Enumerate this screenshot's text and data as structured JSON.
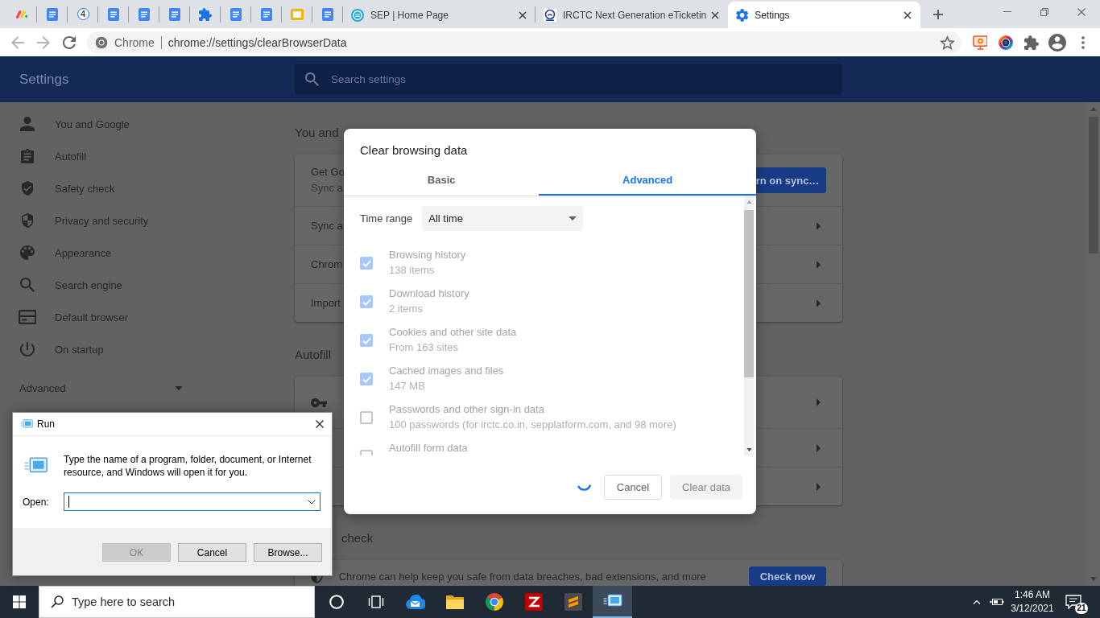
{
  "browser": {
    "pinned_tabs": [
      {
        "kind": "monday"
      },
      {
        "kind": "docs"
      },
      {
        "kind": "badge",
        "label": "4"
      },
      {
        "kind": "docs"
      },
      {
        "kind": "docs"
      },
      {
        "kind": "docs"
      },
      {
        "kind": "extension"
      },
      {
        "kind": "docs"
      },
      {
        "kind": "docs"
      },
      {
        "kind": "slides"
      },
      {
        "kind": "docs"
      }
    ],
    "tabs": [
      {
        "kind": "sep",
        "title": "SEP | Home Page",
        "selected": false
      },
      {
        "kind": "irctc",
        "title": "IRCTC Next Generation eTicketin",
        "selected": false
      },
      {
        "kind": "gear",
        "title": "Settings",
        "selected": true
      }
    ],
    "nav": [
      {
        "kind": "back",
        "disabled": true
      },
      {
        "kind": "forward",
        "disabled": true
      },
      {
        "kind": "reload",
        "disabled": false
      }
    ],
    "omnibox": {
      "chip": "Chrome",
      "url": "chrome://settings/clearBrowserData"
    }
  },
  "settings": {
    "title": "Settings",
    "search": {
      "placeholder": "Search settings"
    },
    "sidebar": {
      "items": [
        {
          "kind": "person",
          "label": "You and Google"
        },
        {
          "kind": "clipboard",
          "label": "Autofill"
        },
        {
          "kind": "shield-check",
          "label": "Safety check"
        },
        {
          "kind": "shield",
          "label": "Privacy and security"
        },
        {
          "kind": "palette",
          "label": "Appearance"
        },
        {
          "kind": "search",
          "label": "Search engine"
        },
        {
          "kind": "browser",
          "label": "Default browser"
        },
        {
          "kind": "power",
          "label": "On startup"
        }
      ],
      "advanced": {
        "label": "Advanced",
        "expanded": false
      }
    },
    "sections": [
      {
        "heading": "You and",
        "rows": [
          {
            "kind": "sync",
            "lines": [
              "Get Go",
              "Sync a"
            ],
            "button": "rn on sync…"
          },
          {
            "kind": "link",
            "label": "Sync a"
          },
          {
            "kind": "link",
            "label": "Chrom"
          },
          {
            "kind": "link",
            "label": "Import"
          }
        ]
      },
      {
        "heading": "Autofill",
        "rows": [
          {
            "kind": "icon-link"
          },
          {
            "kind": "link"
          },
          {
            "kind": "link"
          }
        ]
      },
      {
        "heading": "check",
        "rows": [
          {
            "kind": "action",
            "label": "Chrome can help keep you safe from data breaches, bad extensions, and more",
            "button": "Check now"
          }
        ]
      }
    ]
  },
  "clear_dialog": {
    "title": "Clear browsing data",
    "tabs": [
      {
        "label": "Basic",
        "selected": false
      },
      {
        "label": "Advanced",
        "selected": true
      }
    ],
    "time_range": {
      "label": "Time range",
      "value": "All time"
    },
    "items": [
      {
        "title": "Browsing history",
        "detail": "138 items",
        "checked": true,
        "disabled": true
      },
      {
        "title": "Download history",
        "detail": "2 items",
        "checked": true,
        "disabled": true
      },
      {
        "title": "Cookies and other site data",
        "detail": "From 163 sites",
        "checked": true,
        "disabled": true
      },
      {
        "title": "Cached images and files",
        "detail": "147 MB",
        "checked": true,
        "disabled": true
      },
      {
        "title": "Passwords and other sign-in data",
        "detail": "100 passwords (for irctc.co.in, sepplatform.com, and 98 more)",
        "checked": false,
        "disabled": true
      },
      {
        "title": "Autofill form data",
        "checked": false,
        "disabled": true
      }
    ],
    "busy": true,
    "buttons": [
      {
        "kind": "cancel",
        "label": "Cancel",
        "disabled": false
      },
      {
        "kind": "confirm",
        "label": "Clear data",
        "disabled": true
      }
    ]
  },
  "run_dialog": {
    "title": "Run",
    "message": "Type the name of a program, folder, document, or Internet resource, and Windows will open it for you.",
    "open": {
      "label": "Open:",
      "focused": true
    },
    "buttons": [
      {
        "label": "OK",
        "disabled": true
      },
      {
        "label": "Cancel",
        "disabled": false
      },
      {
        "label": "Browse...",
        "disabled": false
      }
    ]
  },
  "taskbar": {
    "search": {
      "placeholder": "Type here to search"
    },
    "apps": [
      {
        "kind": "cortana",
        "active": false
      },
      {
        "kind": "task-view",
        "active": false
      },
      {
        "kind": "mail",
        "active": false
      },
      {
        "kind": "folder",
        "active": false
      },
      {
        "kind": "chrome",
        "active": false
      },
      {
        "kind": "filezilla",
        "active": false
      },
      {
        "kind": "sublime",
        "active": false
      },
      {
        "kind": "run",
        "active": true
      }
    ],
    "clock": {
      "time": "1:46 AM",
      "date": "3/12/2021"
    },
    "notifications": {
      "count": "21"
    }
  }
}
